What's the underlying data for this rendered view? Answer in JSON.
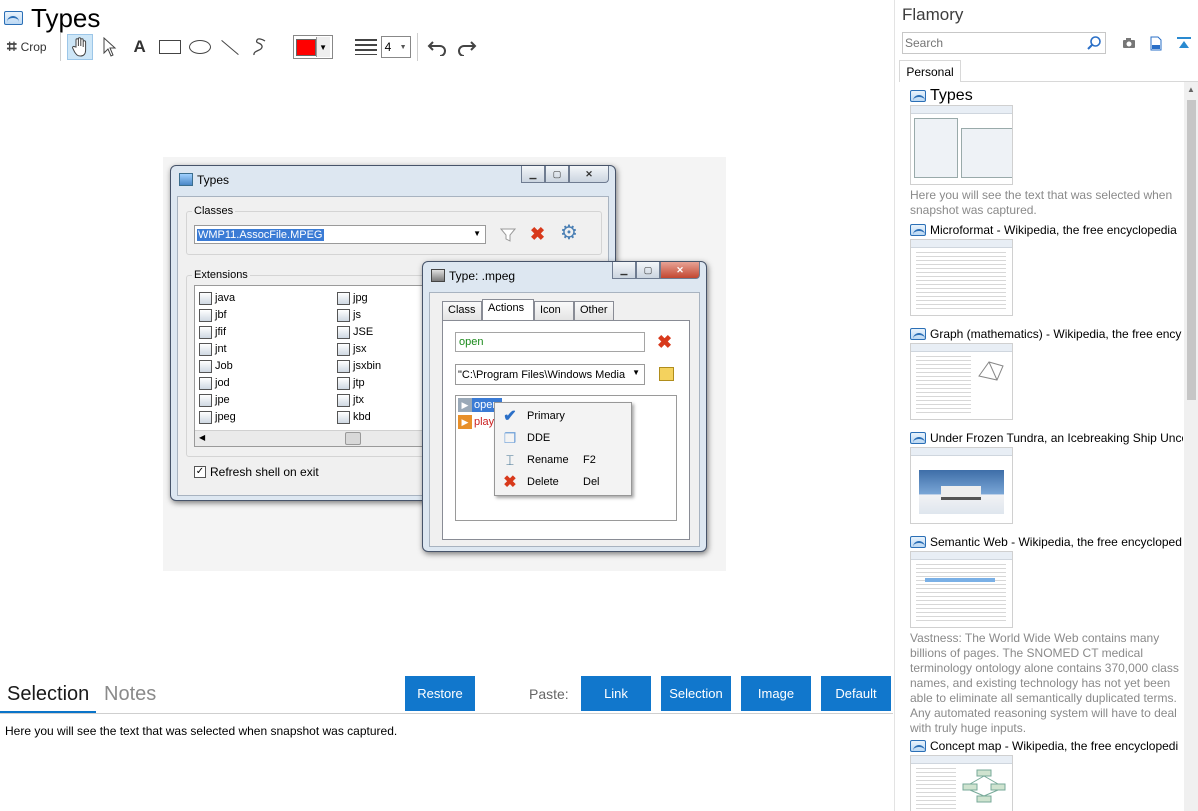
{
  "app": {
    "title": "Types"
  },
  "toolbar": {
    "crop_label": "Crop",
    "color": "#ff0000",
    "line_width": "4"
  },
  "canvas": {
    "types_window": {
      "title": "Types",
      "classes_label": "Classes",
      "class_value": "WMP11.AssocFile.MPEG",
      "extensions_label": "Extensions",
      "extensions_col1": [
        "java",
        "jbf",
        "jfif",
        "jnt",
        "Job",
        "jod",
        "jpe",
        "jpeg"
      ],
      "extensions_col2": [
        "jpg",
        "js",
        "JSE",
        "jsx",
        "jsxbin",
        "jtp",
        "jtx",
        "kbd"
      ],
      "refresh_label": "Refresh shell on exit"
    },
    "type_window": {
      "title": "Type: .mpeg",
      "tabs": [
        "Class",
        "Actions",
        "Icon",
        "Other"
      ],
      "action_value": "open",
      "command_value": "\"C:\\Program Files\\Windows Media",
      "actions": [
        "open",
        "play"
      ]
    },
    "context_menu": [
      {
        "label": "Primary",
        "shortcut": ""
      },
      {
        "label": "DDE",
        "shortcut": ""
      },
      {
        "label": "Rename",
        "shortcut": "F2"
      },
      {
        "label": "Delete",
        "shortcut": "Del"
      }
    ]
  },
  "bottom": {
    "tab_selection": "Selection",
    "tab_notes": "Notes",
    "restore_label": "Restore",
    "paste_label": "Paste:",
    "paste_link": "Link",
    "paste_selection": "Selection",
    "paste_image": "Image",
    "paste_default": "Default",
    "selection_text": "Here you will see the text that was selected when snapshot was captured."
  },
  "sidebar": {
    "brand": "Flamory",
    "search_placeholder": "Search",
    "tab_personal": "Personal",
    "items": [
      {
        "title": "Types",
        "desc": "Here you will see the text that was selected when snapshot was captured."
      },
      {
        "title": "Microformat - Wikipedia, the free encyclopedia",
        "desc": ""
      },
      {
        "title": "Graph (mathematics) - Wikipedia, the free ency",
        "desc": ""
      },
      {
        "title": "Under Frozen Tundra, an Icebreaking Ship Unco",
        "desc": ""
      },
      {
        "title": "Semantic Web - Wikipedia, the free encycloped",
        "desc": "Vastness: The World Wide Web contains many billions of pages. The SNOMED CT medical terminology ontology alone contains 370,000 class names, and existing technology has not yet been able to eliminate all semantically duplicated terms. Any automated reasoning system will have to deal with truly huge inputs."
      },
      {
        "title": "Concept map - Wikipedia, the free encyclopedi",
        "desc": ""
      }
    ]
  },
  "colors": {
    "accent": "#1177cc",
    "delete_red": "#d8391b"
  }
}
